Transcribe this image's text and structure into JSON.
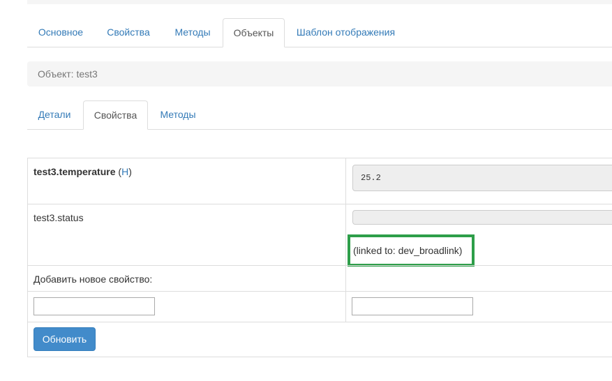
{
  "main_tabs": [
    {
      "label": "Основное"
    },
    {
      "label": "Свойства"
    },
    {
      "label": "Методы"
    },
    {
      "label": "Объекты",
      "active": true
    },
    {
      "label": "Шаблон отображения"
    }
  ],
  "breadcrumb": "Объект: test3",
  "sub_tabs": [
    {
      "label": "Детали"
    },
    {
      "label": "Свойства",
      "active": true
    },
    {
      "label": "Методы"
    }
  ],
  "properties": [
    {
      "name": "test3.temperature",
      "history_link": "H",
      "value": "25.2"
    },
    {
      "name": "test3.status",
      "value": "",
      "linked_text": "(linked to: dev_broadlink)"
    }
  ],
  "add_property_label": "Добавить новое свойство:",
  "new_property": {
    "name_value": "",
    "value_value": ""
  },
  "update_button_label": "Обновить",
  "colors": {
    "link": "#337ab7",
    "button": "#428bca",
    "highlight_border": "#2e9e49"
  }
}
